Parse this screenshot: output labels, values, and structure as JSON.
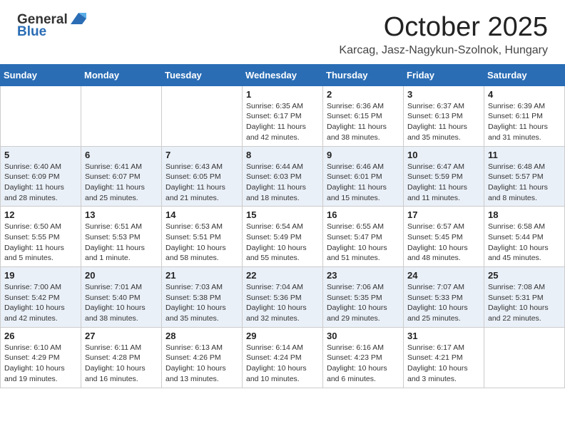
{
  "header": {
    "logo_general": "General",
    "logo_blue": "Blue",
    "month": "October 2025",
    "location": "Karcag, Jasz-Nagykun-Szolnok, Hungary"
  },
  "weekdays": [
    "Sunday",
    "Monday",
    "Tuesday",
    "Wednesday",
    "Thursday",
    "Friday",
    "Saturday"
  ],
  "weeks": [
    [
      {
        "day": "",
        "sunrise": "",
        "sunset": "",
        "daylight": ""
      },
      {
        "day": "",
        "sunrise": "",
        "sunset": "",
        "daylight": ""
      },
      {
        "day": "",
        "sunrise": "",
        "sunset": "",
        "daylight": ""
      },
      {
        "day": "1",
        "sunrise": "Sunrise: 6:35 AM",
        "sunset": "Sunset: 6:17 PM",
        "daylight": "Daylight: 11 hours and 42 minutes."
      },
      {
        "day": "2",
        "sunrise": "Sunrise: 6:36 AM",
        "sunset": "Sunset: 6:15 PM",
        "daylight": "Daylight: 11 hours and 38 minutes."
      },
      {
        "day": "3",
        "sunrise": "Sunrise: 6:37 AM",
        "sunset": "Sunset: 6:13 PM",
        "daylight": "Daylight: 11 hours and 35 minutes."
      },
      {
        "day": "4",
        "sunrise": "Sunrise: 6:39 AM",
        "sunset": "Sunset: 6:11 PM",
        "daylight": "Daylight: 11 hours and 31 minutes."
      }
    ],
    [
      {
        "day": "5",
        "sunrise": "Sunrise: 6:40 AM",
        "sunset": "Sunset: 6:09 PM",
        "daylight": "Daylight: 11 hours and 28 minutes."
      },
      {
        "day": "6",
        "sunrise": "Sunrise: 6:41 AM",
        "sunset": "Sunset: 6:07 PM",
        "daylight": "Daylight: 11 hours and 25 minutes."
      },
      {
        "day": "7",
        "sunrise": "Sunrise: 6:43 AM",
        "sunset": "Sunset: 6:05 PM",
        "daylight": "Daylight: 11 hours and 21 minutes."
      },
      {
        "day": "8",
        "sunrise": "Sunrise: 6:44 AM",
        "sunset": "Sunset: 6:03 PM",
        "daylight": "Daylight: 11 hours and 18 minutes."
      },
      {
        "day": "9",
        "sunrise": "Sunrise: 6:46 AM",
        "sunset": "Sunset: 6:01 PM",
        "daylight": "Daylight: 11 hours and 15 minutes."
      },
      {
        "day": "10",
        "sunrise": "Sunrise: 6:47 AM",
        "sunset": "Sunset: 5:59 PM",
        "daylight": "Daylight: 11 hours and 11 minutes."
      },
      {
        "day": "11",
        "sunrise": "Sunrise: 6:48 AM",
        "sunset": "Sunset: 5:57 PM",
        "daylight": "Daylight: 11 hours and 8 minutes."
      }
    ],
    [
      {
        "day": "12",
        "sunrise": "Sunrise: 6:50 AM",
        "sunset": "Sunset: 5:55 PM",
        "daylight": "Daylight: 11 hours and 5 minutes."
      },
      {
        "day": "13",
        "sunrise": "Sunrise: 6:51 AM",
        "sunset": "Sunset: 5:53 PM",
        "daylight": "Daylight: 11 hours and 1 minute."
      },
      {
        "day": "14",
        "sunrise": "Sunrise: 6:53 AM",
        "sunset": "Sunset: 5:51 PM",
        "daylight": "Daylight: 10 hours and 58 minutes."
      },
      {
        "day": "15",
        "sunrise": "Sunrise: 6:54 AM",
        "sunset": "Sunset: 5:49 PM",
        "daylight": "Daylight: 10 hours and 55 minutes."
      },
      {
        "day": "16",
        "sunrise": "Sunrise: 6:55 AM",
        "sunset": "Sunset: 5:47 PM",
        "daylight": "Daylight: 10 hours and 51 minutes."
      },
      {
        "day": "17",
        "sunrise": "Sunrise: 6:57 AM",
        "sunset": "Sunset: 5:45 PM",
        "daylight": "Daylight: 10 hours and 48 minutes."
      },
      {
        "day": "18",
        "sunrise": "Sunrise: 6:58 AM",
        "sunset": "Sunset: 5:44 PM",
        "daylight": "Daylight: 10 hours and 45 minutes."
      }
    ],
    [
      {
        "day": "19",
        "sunrise": "Sunrise: 7:00 AM",
        "sunset": "Sunset: 5:42 PM",
        "daylight": "Daylight: 10 hours and 42 minutes."
      },
      {
        "day": "20",
        "sunrise": "Sunrise: 7:01 AM",
        "sunset": "Sunset: 5:40 PM",
        "daylight": "Daylight: 10 hours and 38 minutes."
      },
      {
        "day": "21",
        "sunrise": "Sunrise: 7:03 AM",
        "sunset": "Sunset: 5:38 PM",
        "daylight": "Daylight: 10 hours and 35 minutes."
      },
      {
        "day": "22",
        "sunrise": "Sunrise: 7:04 AM",
        "sunset": "Sunset: 5:36 PM",
        "daylight": "Daylight: 10 hours and 32 minutes."
      },
      {
        "day": "23",
        "sunrise": "Sunrise: 7:06 AM",
        "sunset": "Sunset: 5:35 PM",
        "daylight": "Daylight: 10 hours and 29 minutes."
      },
      {
        "day": "24",
        "sunrise": "Sunrise: 7:07 AM",
        "sunset": "Sunset: 5:33 PM",
        "daylight": "Daylight: 10 hours and 25 minutes."
      },
      {
        "day": "25",
        "sunrise": "Sunrise: 7:08 AM",
        "sunset": "Sunset: 5:31 PM",
        "daylight": "Daylight: 10 hours and 22 minutes."
      }
    ],
    [
      {
        "day": "26",
        "sunrise": "Sunrise: 6:10 AM",
        "sunset": "Sunset: 4:29 PM",
        "daylight": "Daylight: 10 hours and 19 minutes."
      },
      {
        "day": "27",
        "sunrise": "Sunrise: 6:11 AM",
        "sunset": "Sunset: 4:28 PM",
        "daylight": "Daylight: 10 hours and 16 minutes."
      },
      {
        "day": "28",
        "sunrise": "Sunrise: 6:13 AM",
        "sunset": "Sunset: 4:26 PM",
        "daylight": "Daylight: 10 hours and 13 minutes."
      },
      {
        "day": "29",
        "sunrise": "Sunrise: 6:14 AM",
        "sunset": "Sunset: 4:24 PM",
        "daylight": "Daylight: 10 hours and 10 minutes."
      },
      {
        "day": "30",
        "sunrise": "Sunrise: 6:16 AM",
        "sunset": "Sunset: 4:23 PM",
        "daylight": "Daylight: 10 hours and 6 minutes."
      },
      {
        "day": "31",
        "sunrise": "Sunrise: 6:17 AM",
        "sunset": "Sunset: 4:21 PM",
        "daylight": "Daylight: 10 hours and 3 minutes."
      },
      {
        "day": "",
        "sunrise": "",
        "sunset": "",
        "daylight": ""
      }
    ]
  ]
}
